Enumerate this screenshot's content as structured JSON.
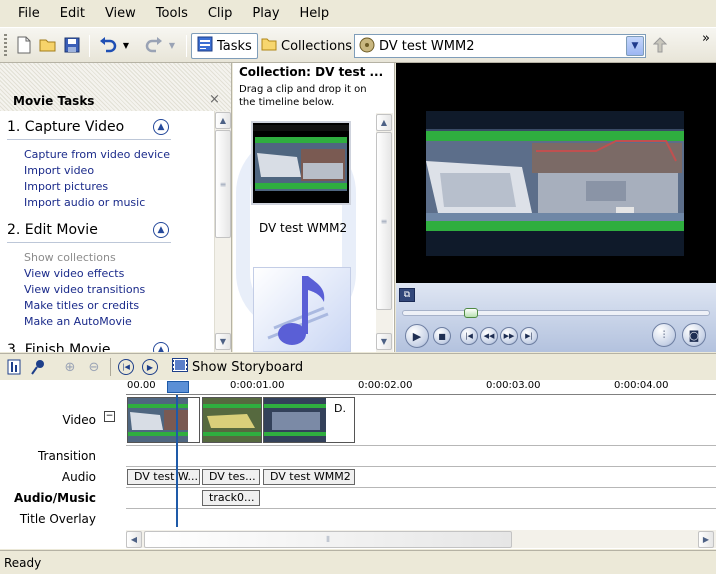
{
  "menu": [
    "File",
    "Edit",
    "View",
    "Tools",
    "Clip",
    "Play",
    "Help"
  ],
  "toolbar": {
    "tasks_label": "Tasks",
    "collections_label": "Collections",
    "collection_value": "DV test WMM2",
    "overflow": "»"
  },
  "tasks": {
    "title": "Movie Tasks",
    "close": "×",
    "sections": [
      {
        "title": "1. Capture Video",
        "links": [
          "Capture from video device",
          "Import video",
          "Import pictures",
          "Import audio or music"
        ]
      },
      {
        "title": "2. Edit Movie",
        "links": [
          "Show collections",
          "View video effects",
          "View video transitions",
          "Make titles or credits",
          "Make an AutoMovie"
        ]
      },
      {
        "title": "3. Finish Movie",
        "links": []
      }
    ]
  },
  "collection": {
    "title": "Collection: DV test ...",
    "hint": "Drag a clip and drop it on the timeline below.",
    "clips": [
      "DV test WMM2"
    ]
  },
  "timeline": {
    "storyboard_label": "Show Storyboard",
    "ruler": [
      "00.00",
      "0:00:01.00",
      "0:00:02.00",
      "0:00:03.00",
      "0:00:04.00"
    ],
    "tracks": [
      "Video",
      "Transition",
      "Audio",
      "Audio/Music",
      "Title Overlay"
    ],
    "video_tail_label": "D.",
    "audio_clips": [
      "DV test W...",
      "DV tes...",
      "DV test WMM2"
    ],
    "music_clips": [
      "track0..."
    ]
  },
  "status": "Ready",
  "colors": {
    "link": "#1a2a8a",
    "playhead": "#1e5aa8",
    "accent_green": "#2fae3f"
  }
}
